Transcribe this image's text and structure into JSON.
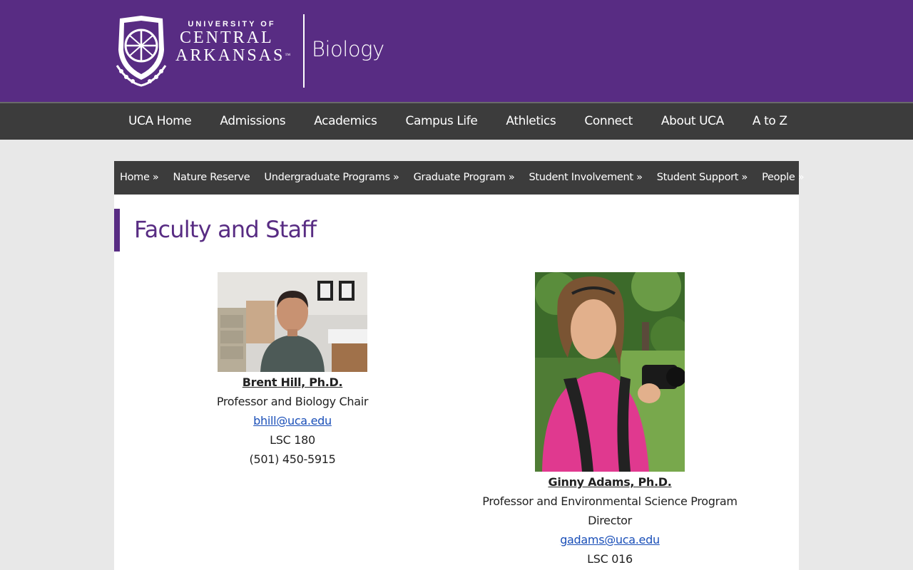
{
  "header": {
    "logo_line1": "UNIVERSITY OF",
    "logo_line2": "CENTRAL",
    "logo_line3": "ARKANSAS",
    "logo_tm": "™",
    "site_name": "Biology"
  },
  "main_nav": [
    {
      "label": "UCA Home"
    },
    {
      "label": "Admissions"
    },
    {
      "label": "Academics"
    },
    {
      "label": "Campus Life"
    },
    {
      "label": "Athletics"
    },
    {
      "label": "Connect"
    },
    {
      "label": "About UCA"
    },
    {
      "label": "A to Z"
    }
  ],
  "sub_nav": [
    {
      "label": "Home »"
    },
    {
      "label": "Nature Reserve"
    },
    {
      "label": "Undergraduate Programs »"
    },
    {
      "label": "Graduate Program »"
    },
    {
      "label": "Student Involvement »"
    },
    {
      "label": "Student Support »"
    },
    {
      "label": "People »"
    }
  ],
  "page_title": "Faculty and Staff",
  "people": [
    {
      "name": "Brent Hill, Ph.D.",
      "title": "Professor and Biology Chair",
      "email": "bhill@uca.edu",
      "office": "LSC 180",
      "phone": "(501) 450-5915"
    },
    {
      "name": "Ginny Adams, Ph.D.",
      "title_line1": "Professor and Environmental Science Program",
      "title_line2": "Director",
      "email": "gadams@uca.edu",
      "office": "LSC 016"
    }
  ],
  "colors": {
    "brand_purple": "#582c83",
    "nav_dark": "#3c3c3c",
    "link_blue": "#1a4fb8"
  }
}
